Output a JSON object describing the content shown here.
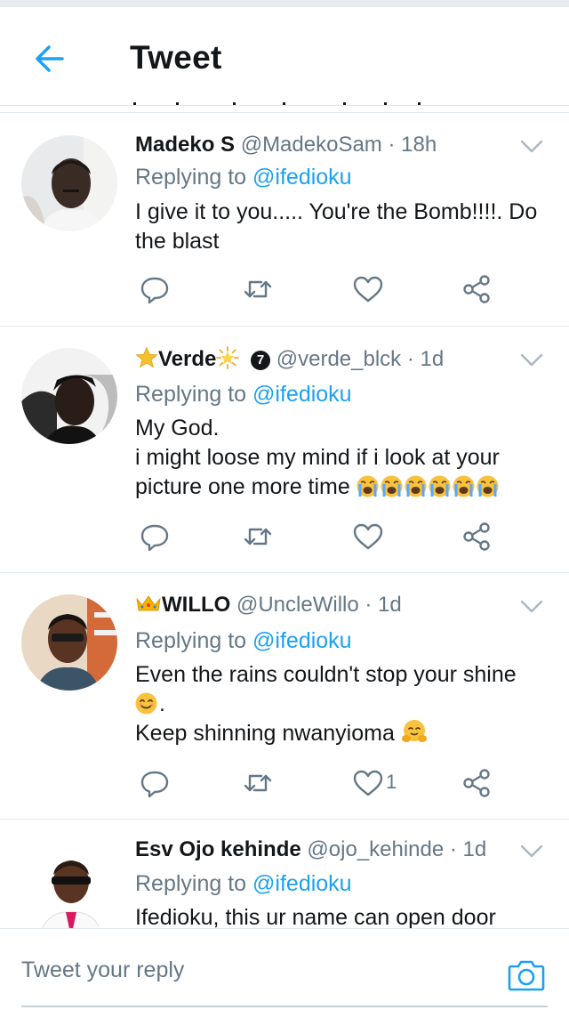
{
  "header": {
    "title": "Tweet",
    "back_icon": "arrow-left-icon"
  },
  "colors": {
    "accent": "#1da1f2",
    "text": "#14171a",
    "muted": "#657786",
    "divider": "#e1e8ed"
  },
  "tweets": [
    {
      "name": "Madeko S",
      "handle": "@MadekoSam",
      "time": "· 18h",
      "replying_prefix": "Replying to ",
      "replying_to": "@ifedioku",
      "lines": [
        "I give it to you..... You're the Bomb!!!!. Do",
        "the blast"
      ],
      "likes": ""
    },
    {
      "name": "Verde",
      "handle": "@verde_blck",
      "time": "· 1d",
      "badge": "7",
      "replying_prefix": "Replying to ",
      "replying_to": "@ifedioku",
      "lines": [
        "My God.",
        "i might loose my mind if i look at your",
        "picture one more time"
      ],
      "likes": ""
    },
    {
      "name": "WILLO",
      "handle": "@UncleWillo",
      "time": "· 1d",
      "replying_prefix": "Replying to ",
      "replying_to": "@ifedioku",
      "lines": [
        "Even the rains couldn't stop your shine",
        ".",
        "Keep shinning nwanyioma"
      ],
      "likes": "1"
    },
    {
      "name": "Esv Ojo kehinde",
      "handle": "@ojo_kehinde",
      "time": "· 1d",
      "replying_prefix": "Replying to ",
      "replying_to": "@ifedioku",
      "lines": [
        "Ifedioku, this ur name can open door"
      ],
      "likes": ""
    }
  ],
  "reply_bar": {
    "placeholder": "Tweet your reply",
    "camera_icon": "camera-icon"
  }
}
